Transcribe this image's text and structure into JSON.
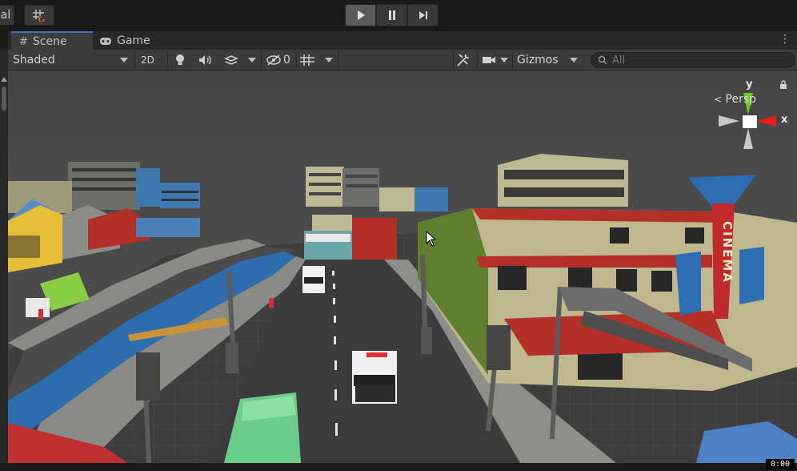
{
  "toolbar": {
    "left_cut_label": "al",
    "play_icon": "play-icon",
    "pause_icon": "pause-icon",
    "step_icon": "step-icon"
  },
  "tabs": [
    {
      "label": "Scene",
      "icon": "grid-hash-icon",
      "active": true
    },
    {
      "label": "Game",
      "icon": "gamepad-icon",
      "active": false
    }
  ],
  "scene_toolbar": {
    "draw_mode": "Shaded",
    "mode_2d": "2D",
    "hidden_count": "0",
    "gizmos_label": "Gizmos",
    "search_placeholder": "All"
  },
  "viewport": {
    "projection_label": "Persp",
    "axis_x": "x",
    "axis_y": "y",
    "cinema_sign": "CINEMA",
    "timer": "0:00"
  },
  "colors": {
    "accent_tab": "#3a79bb",
    "axis_x": "#e0201c",
    "axis_y": "#5fd11a",
    "water": "#2e6dad"
  }
}
